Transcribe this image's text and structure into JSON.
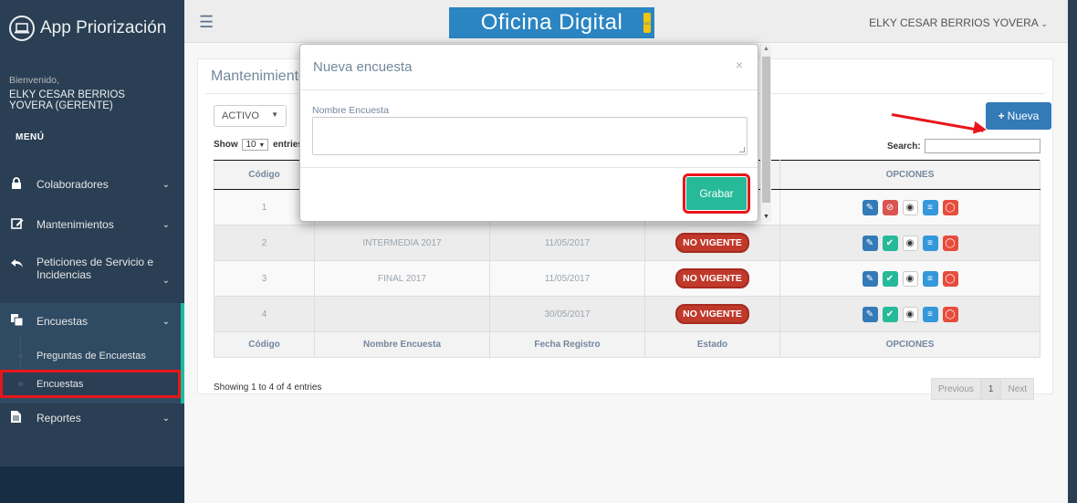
{
  "sidebar": {
    "brand_title": "App Priorización",
    "welcome": "Bienvenido,",
    "user_name": "ELKY CESAR BERRIOS YOVERA (GERENTE)",
    "menu_label": "MENÚ",
    "items": [
      {
        "label": "Colaboradores",
        "icon": "lock-icon"
      },
      {
        "label": "Mantenimientos",
        "icon": "edit-icon"
      },
      {
        "label": "Peticiones de Servicio e Incidencias",
        "icon": "reply-all-icon"
      },
      {
        "label": "Encuestas",
        "icon": "clone-icon"
      },
      {
        "label": "Reportes",
        "icon": "file-icon"
      }
    ],
    "sub_items": [
      {
        "label": "Preguntas de Encuestas"
      },
      {
        "label": "Encuestas"
      }
    ]
  },
  "topnav": {
    "logo_text": "Oficina Digital",
    "logo_sub": "SAC",
    "user_menu": "ELKY CESAR BERRIOS YOVERA"
  },
  "panel": {
    "title": "Mantenimiento",
    "status_select": "ACTIVO",
    "new_button": "Nueva",
    "show_prefix": "Show",
    "show_value": "10",
    "show_suffix": "entries",
    "search_label": "Search:",
    "columns": [
      "Código",
      "Nombre Encuesta",
      "Fecha Registro",
      "Estado",
      "OPCIONES"
    ],
    "rows": [
      {
        "codigo": "1",
        "nombre": "",
        "fecha": "",
        "estado": ""
      },
      {
        "codigo": "2",
        "nombre": "INTERMEDIA 2017",
        "fecha": "11/05/2017",
        "estado": "NO VIGENTE"
      },
      {
        "codigo": "3",
        "nombre": "FINAL 2017",
        "fecha": "11/05/2017",
        "estado": "NO VIGENTE"
      },
      {
        "codigo": "4",
        "nombre": "",
        "fecha": "30/05/2017",
        "estado": "NO VIGENTE"
      }
    ],
    "showing": "Showing 1 to 4 of 4 entries",
    "pager": {
      "previous": "Previous",
      "page": "1",
      "next": "Next"
    }
  },
  "modal": {
    "title": "Nueva encuesta",
    "close": "×",
    "field_label": "Nombre Encuesta",
    "field_value": "",
    "save_button": "Grabar"
  },
  "colors": {
    "sidebar_bg": "#2a3f54",
    "accent_green": "#26b99a",
    "primary_blue": "#337ab7",
    "danger_red": "#c0392b",
    "highlight_red": "#e8161b"
  }
}
